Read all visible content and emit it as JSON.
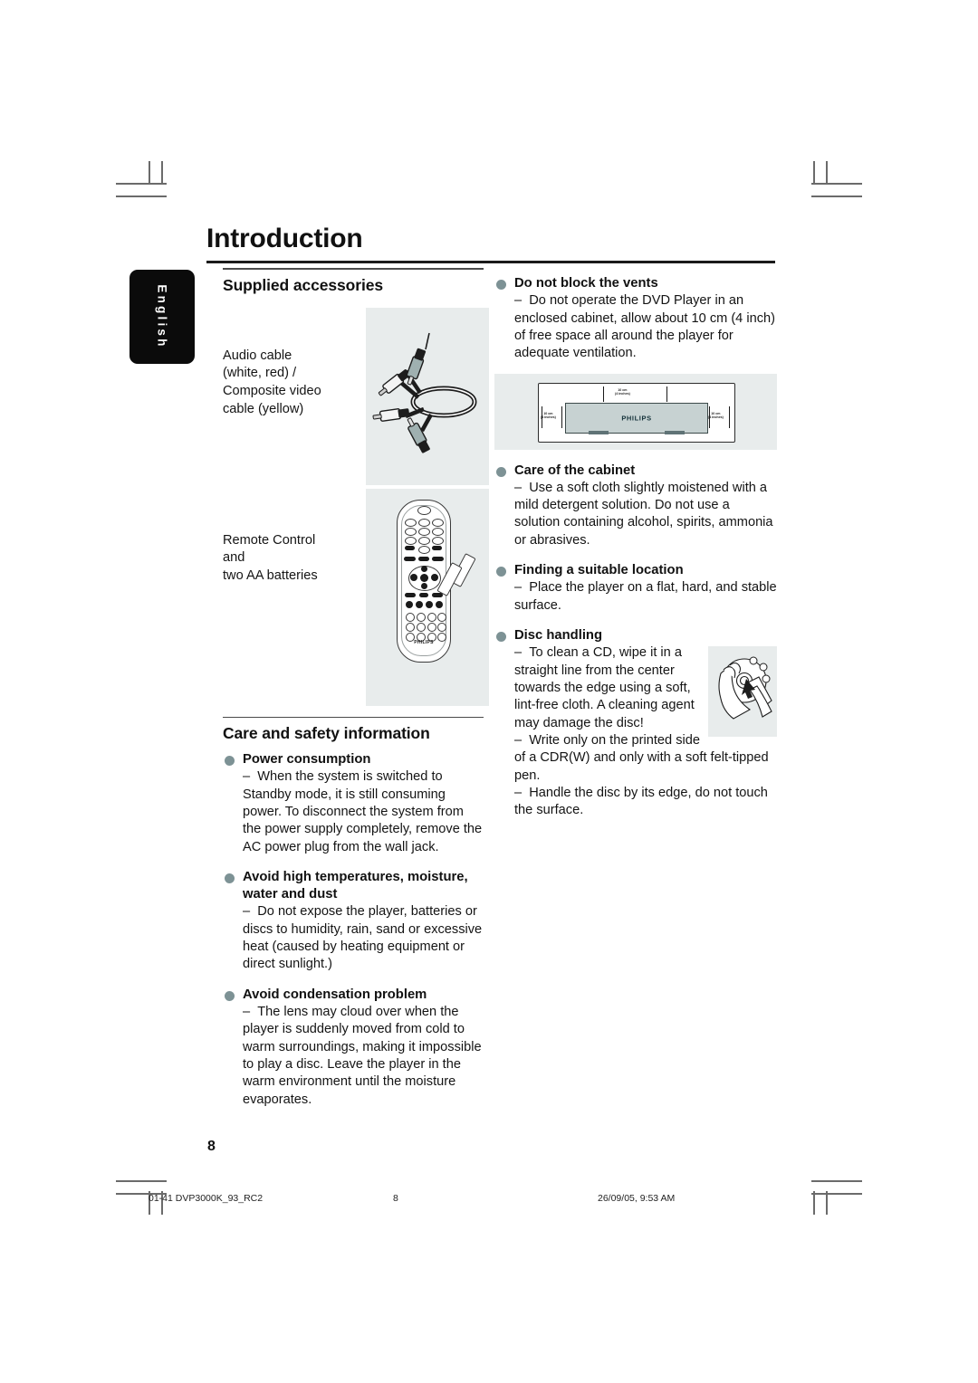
{
  "document": {
    "title": "Introduction",
    "language_tab": "English",
    "page_number": "8"
  },
  "left_column": {
    "section1": {
      "heading": "Supplied accessories",
      "items": [
        {
          "text": "Audio cable\n(white, red) /\nComposite video\ncable (yellow)",
          "image_name": "audio-video-cable-photo"
        },
        {
          "text": "Remote Control\nand\ntwo AA batteries",
          "image_name": "remote-control-batteries-photo"
        }
      ]
    },
    "section2": {
      "heading": "Care and safety information",
      "bullets": [
        {
          "title": "Power consumption",
          "body": "When the system is switched to Standby mode, it is still consuming power. To disconnect the system from the power supply completely, remove the AC power plug from the wall jack."
        },
        {
          "title": "Avoid high temperatures, moisture, water and dust",
          "body": "Do not expose the player, batteries or discs to humidity, rain, sand or excessive heat (caused by heating equipment or direct sunlight.)"
        },
        {
          "title": "Avoid condensation problem",
          "body": "The lens may cloud over when the player is suddenly moved from cold to warm surroundings, making it impossible to play a disc. Leave the player in the warm environment until the moisture evaporates."
        }
      ]
    }
  },
  "right_column": {
    "bullets": [
      {
        "title": "Do not block the vents",
        "body": "Do not operate the DVD Player in an enclosed cabinet, allow about 10 cm (4 inch) of free space all around the player for adequate ventilation."
      },
      {
        "title": "Care of the cabinet",
        "body": "Use a soft cloth slightly moistened with a mild detergent solution. Do not use a solution containing alcohol, spirits, ammonia or abrasives."
      },
      {
        "title": "Finding a suitable location",
        "body": "Place the player on a flat, hard, and stable surface."
      },
      {
        "title": "Disc handling",
        "body1": "To clean a CD, wipe it in a straight line from the center towards the edge using a soft, lint-free cloth. A cleaning agent may damage the disc!",
        "body2": "Write only on the printed side of a CDR(W) and only with a soft felt-tipped pen.",
        "body3": "Handle the disc by its edge, do not touch the surface."
      }
    ],
    "ventilation_diagram": {
      "image_name": "ventilation-clearance-diagram",
      "device_label": "PHILIPS",
      "dim_top": "10 cm\n(4 inches)",
      "dim_left": "10 cm\n(4 inches)",
      "dim_right": "10 cm\n(4 inches)"
    },
    "disc_handling_image": "hands-cleaning-disc-illustration"
  },
  "footer": {
    "file": "01-41 DVP3000K_93_RC2",
    "page": "8",
    "date": "26/09/05, 9:53 AM"
  },
  "colors": {
    "bullet": "#7d9295",
    "panel_bg": "#e8ecec",
    "device_fill": "#c7d2d2",
    "rule": "#1a1a1a"
  }
}
